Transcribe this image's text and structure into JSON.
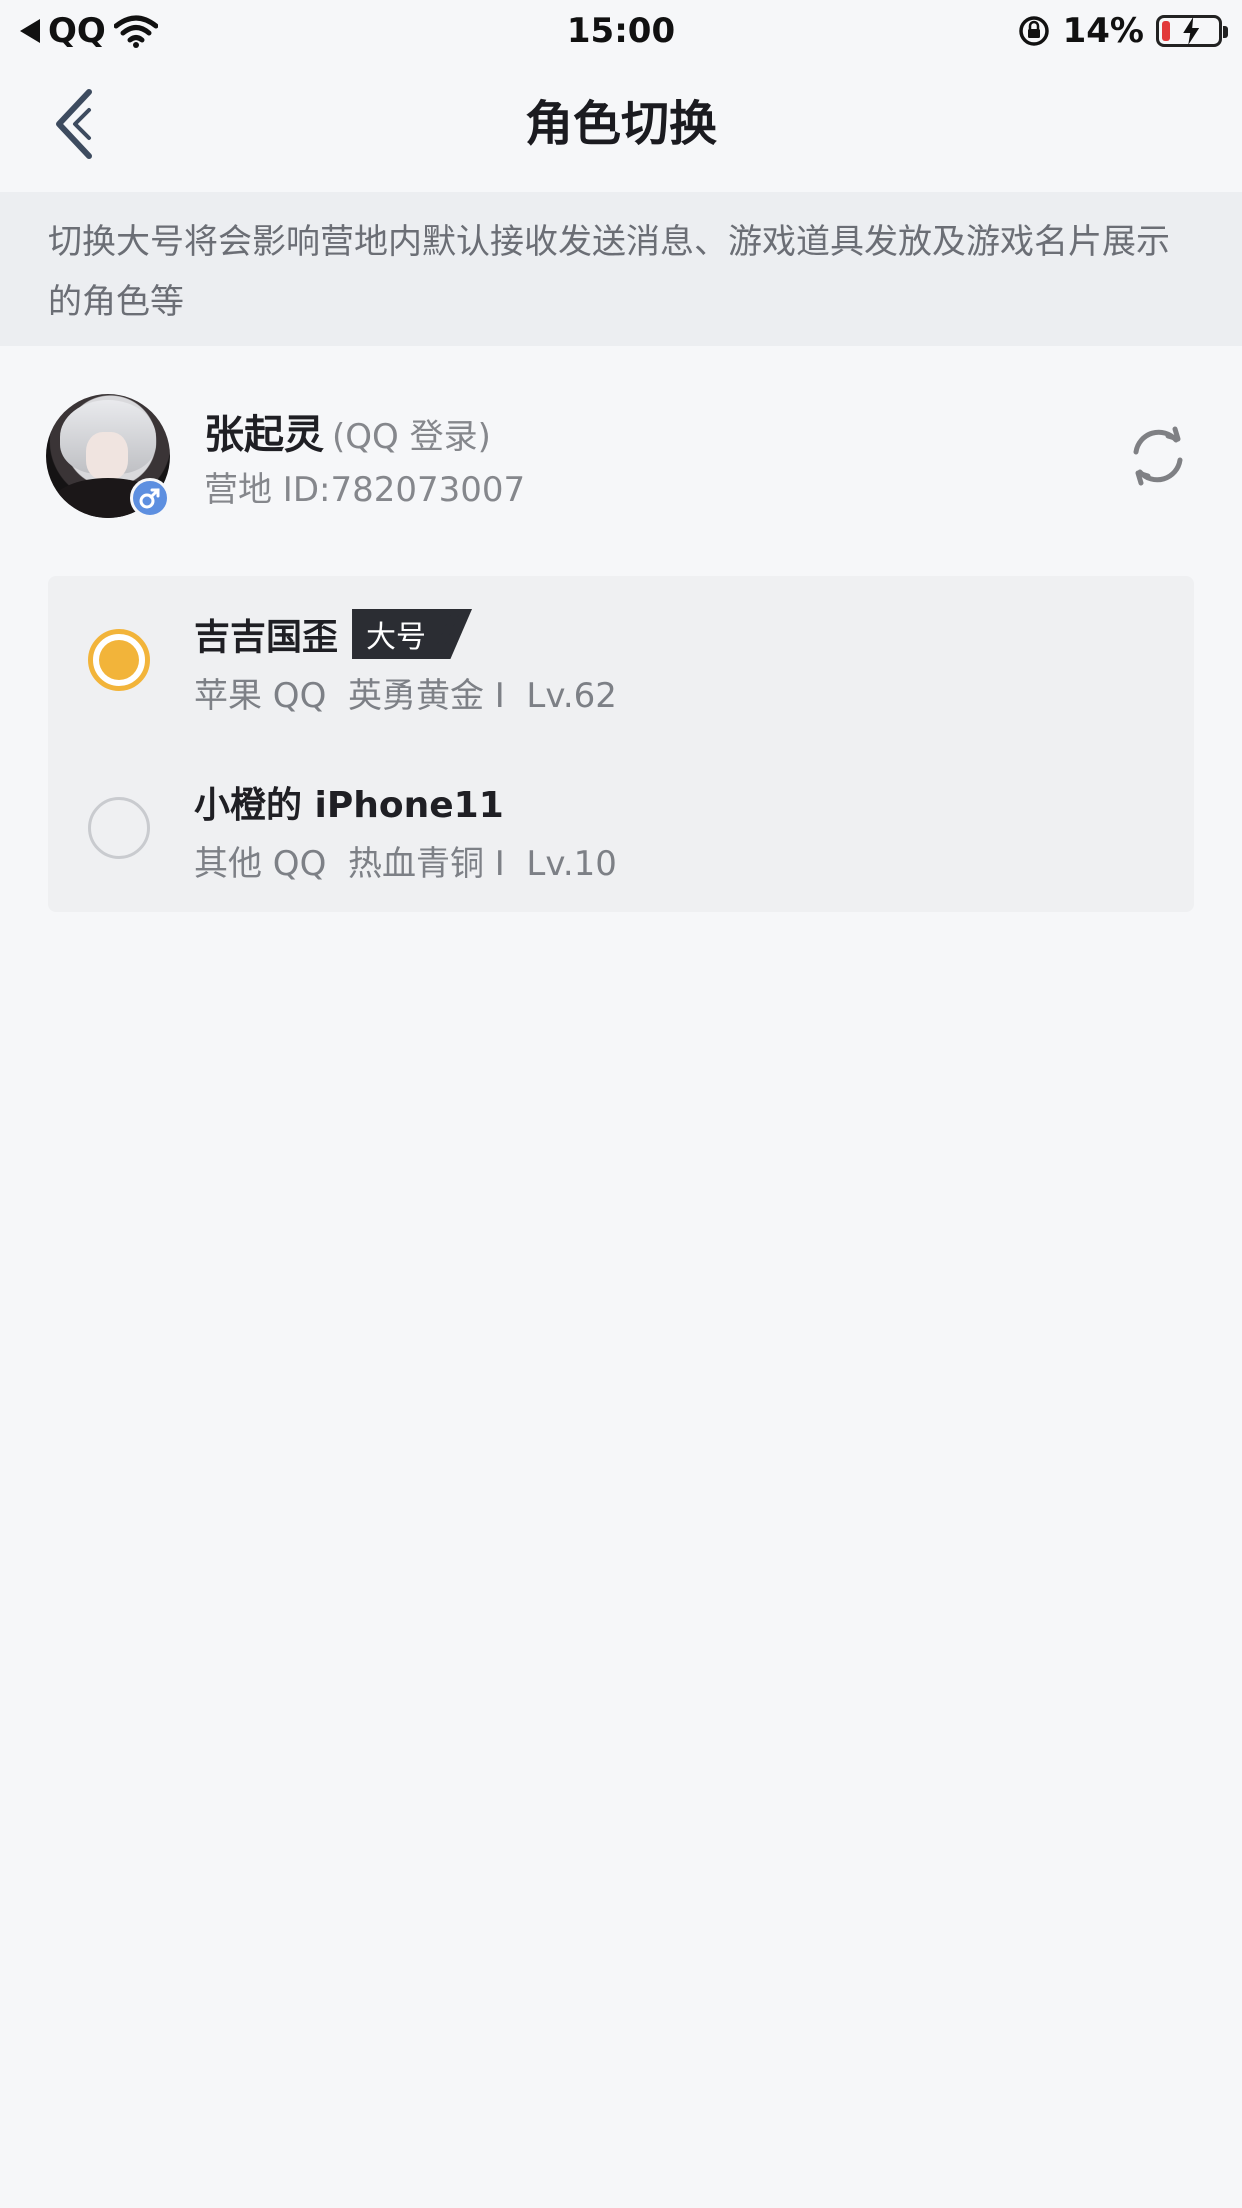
{
  "status_bar": {
    "back_app": "QQ",
    "time": "15:00",
    "battery_percent": "14%",
    "battery_level": 0.14,
    "battery_color": "#e2393a",
    "icons": [
      "back-triangle-icon",
      "wifi-icon",
      "rotation-lock-icon",
      "battery-charging-icon"
    ]
  },
  "nav": {
    "title": "角色切换",
    "back_icon": "chevron-left-icon"
  },
  "notice": {
    "text": "切换大号将会影响营地内默认接收发送消息、游戏道具发放及游戏名片展示的角色等"
  },
  "profile": {
    "name": "张起灵",
    "login_type": "(QQ 登录)",
    "camp_id": "营地 ID:782073007",
    "gender_icon": "male-icon",
    "gender_color": "#5d8fe0",
    "refresh_icon": "refresh-icon"
  },
  "roles": [
    {
      "name": "吉吉国歪",
      "tag": "大号",
      "detail": "苹果 QQ  英勇黄金 I  Lv.62",
      "selected": true
    },
    {
      "name": "小橙的 iPhone11",
      "tag": "",
      "detail": "其他 QQ  热血青铜 I  Lv.10",
      "selected": false
    }
  ],
  "colors": {
    "accent": "#f2b43a",
    "background": "#f6f7f9",
    "notice_bg": "#eceef1",
    "tag_bg": "#2b2d33"
  }
}
